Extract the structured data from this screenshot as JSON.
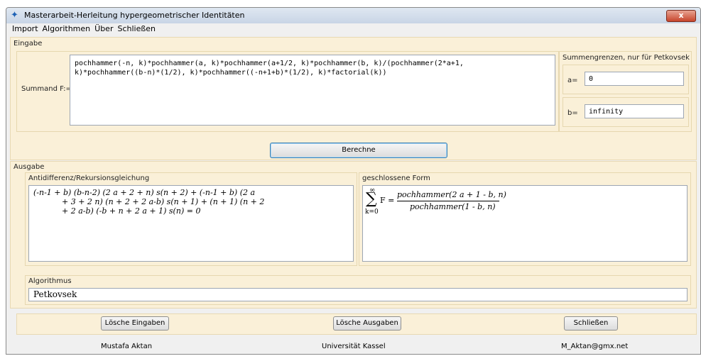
{
  "window": {
    "title": "Masterarbeit-Herleitung hypergeometrischer Identitäten",
    "close_glyph": "x"
  },
  "menu": [
    "Import",
    "Algorithmen",
    "Über",
    "Schließen"
  ],
  "eingabe": {
    "label": "Eingabe",
    "summand_label": "Summand F:=",
    "summand_lines": [
      "pochhammer(-n, k)*pochhammer(a, k)*pochhammer(a+1/2, k)*pochhammer(b, k)/(pochhammer(2*a+1,",
      "k)*pochhammer((b-n)*(1/2), k)*pochhammer((-n+1+b)*(1/2), k)*factorial(k))"
    ],
    "grenzen_label": "Summengrenzen, nur für Petkovsek",
    "a_label": "a=",
    "a_value": "0",
    "b_label": "b=",
    "b_value": "infinity",
    "berechne": "Berechne"
  },
  "ausgabe": {
    "label": "Ausgabe",
    "anti_label": "Antidifferenz/Rekursionsgleichung",
    "anti_lines": [
      "(-n-1 + b) (b-n-2) (2 a + 2 + n) s(n + 2) + (-n-1 + b) (2 a",
      "+ 3 + 2 n) (n + 2 + 2 a-b) s(n + 1) + (n + 1) (n + 2",
      "+ 2 a-b) (-b + n + 2 a + 1) s(n) = 0"
    ],
    "closed_label": "geschlossene Form",
    "closed_upper": "∞",
    "closed_sigma": "∑",
    "closed_lower": "k=0",
    "closed_F": "F =",
    "closed_num": "pochhammer(2 a + 1 - b, n)",
    "closed_den": "pochhammer(1 - b, n)",
    "algo_label": "Algorithmus",
    "algo_value": "Petkovsek"
  },
  "buttons": {
    "loesche_eingaben": "Lösche Eingaben",
    "loesche_ausgaben": "Lösche Ausgaben",
    "schliessen": "Schließen"
  },
  "footer": {
    "author": "Mustafa Aktan",
    "university": "Universität Kassel",
    "email": "M_Aktan@gmx.net"
  }
}
